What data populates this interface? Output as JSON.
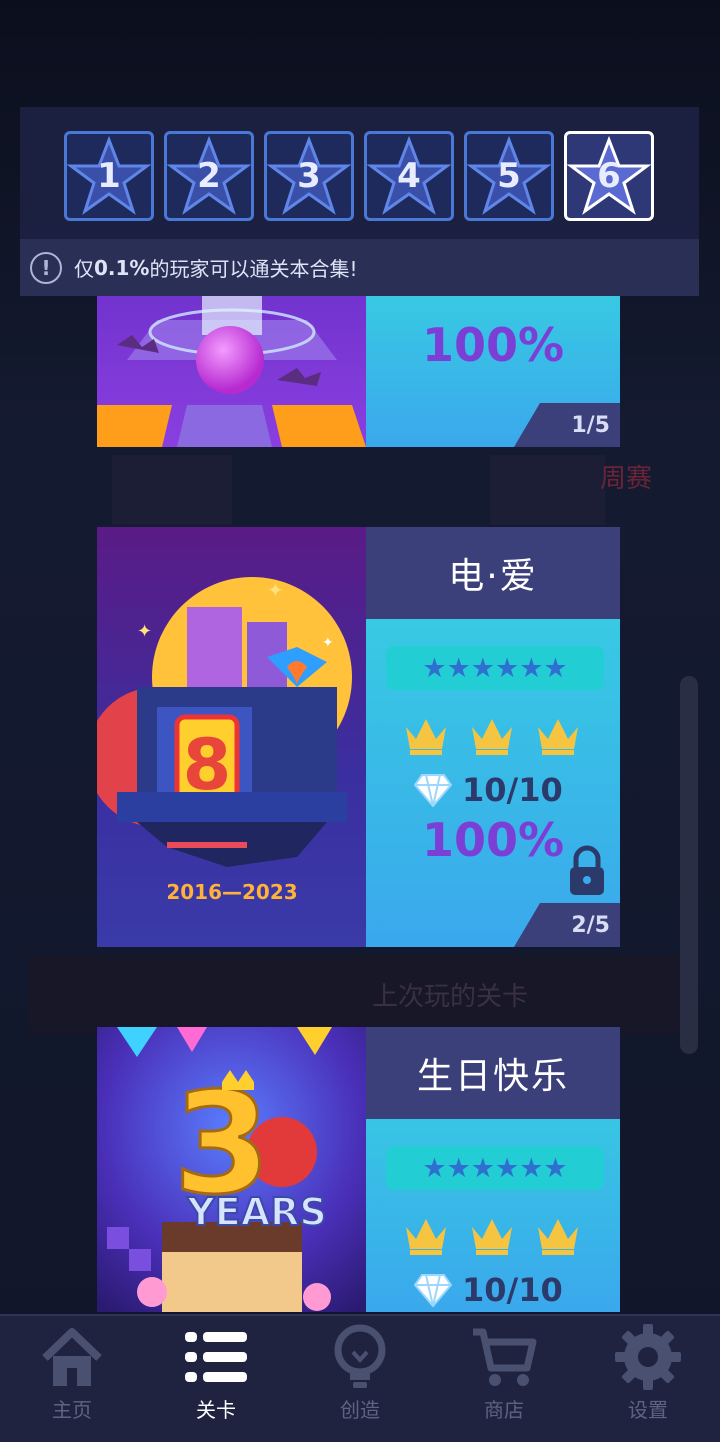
{
  "background_ghost": {
    "weekly_label": "周赛",
    "last_played_label": "上次玩的关卡"
  },
  "level_selector": {
    "levels": [
      "1",
      "2",
      "3",
      "4",
      "5",
      "6"
    ],
    "active_index": 6,
    "notice_prefix": "仅",
    "notice_highlight": "0.1%",
    "notice_suffix": "的玩家可以通关本合集!"
  },
  "cards": [
    {
      "percent": "100%",
      "page": "1/5"
    },
    {
      "title": "电·爱",
      "stars": "★★★★★★",
      "diamonds": "10/10",
      "percent": "100%",
      "page": "2/5",
      "art_digit": "8",
      "art_years": "2016—2023"
    },
    {
      "title": "生日快乐",
      "stars": "★★★★★★",
      "diamonds": "10/10",
      "art_digit": "3",
      "art_word": "YEARS"
    }
  ],
  "bottom_nav": {
    "items": [
      {
        "label": "主页",
        "icon": "home-icon"
      },
      {
        "label": "关卡",
        "icon": "list-icon"
      },
      {
        "label": "创造",
        "icon": "lightbulb-icon"
      },
      {
        "label": "商店",
        "icon": "cart-icon"
      },
      {
        "label": "设置",
        "icon": "gear-icon"
      }
    ],
    "active_index": 1
  },
  "colors": {
    "panel_dark": "#3b3f7a",
    "percent_purple": "#7c3fd6",
    "crown_gold": "#f5c542",
    "nav_bg": "#1f2340"
  }
}
